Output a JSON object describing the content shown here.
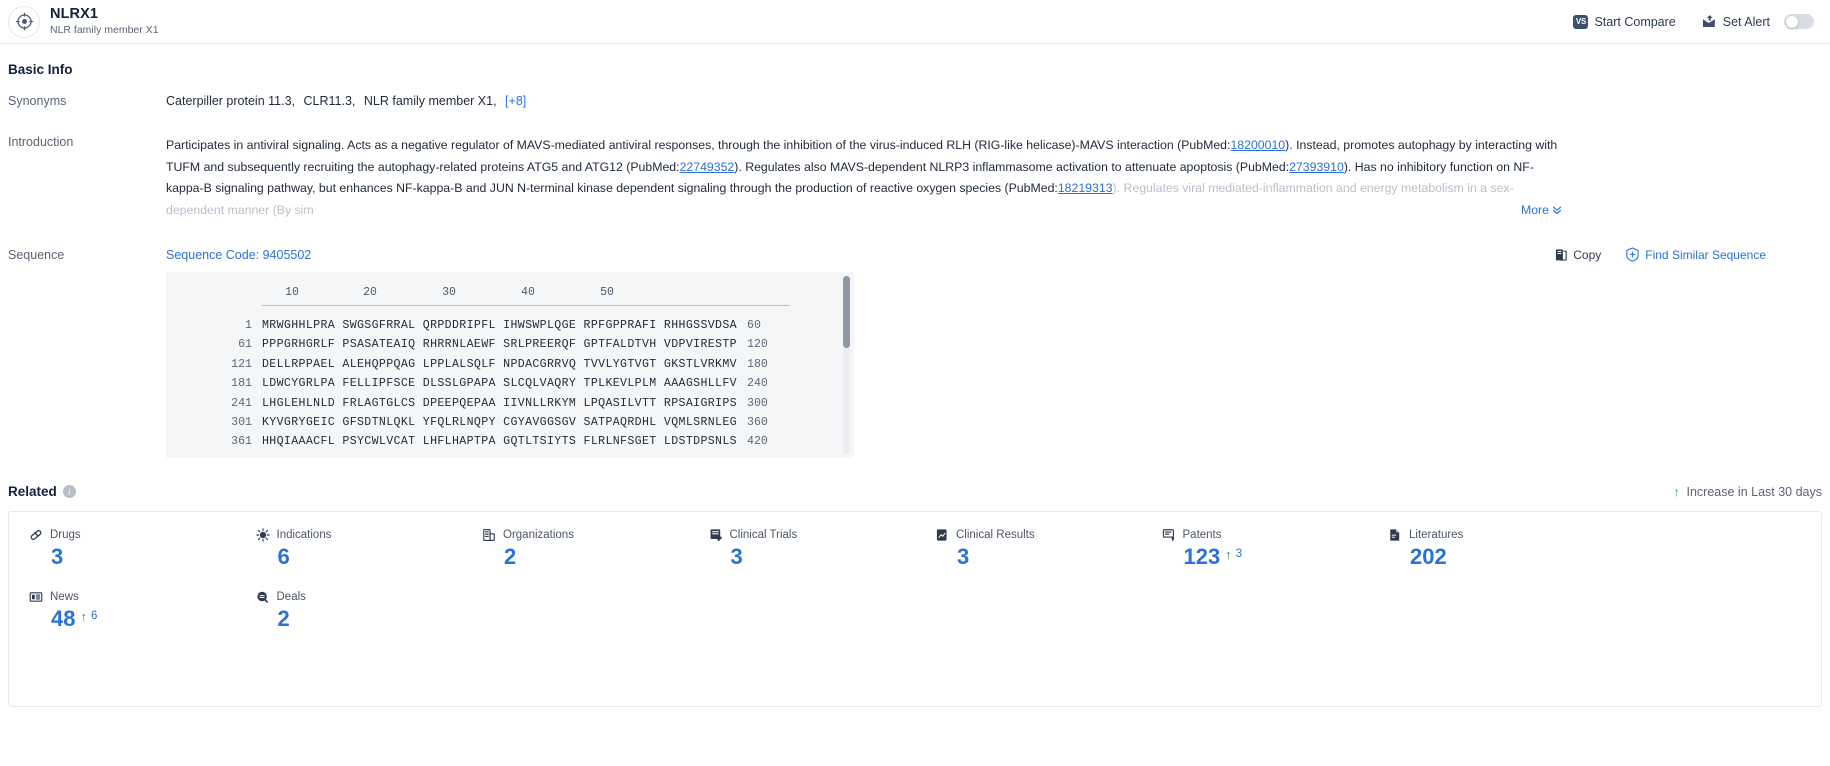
{
  "header": {
    "gene_symbol": "NLRX1",
    "gene_name": "NLR family member X1",
    "logo_icon": "target-crosshair-icon",
    "start_compare_label": "Start Compare",
    "vs_badge_text": "VS",
    "set_alert_label": "Set Alert",
    "alert_toggle_state": "off"
  },
  "basic_info": {
    "title": "Basic Info",
    "synonyms": {
      "label": "Synonyms",
      "values": [
        "Caterpiller protein 11.3,",
        "CLR11.3,",
        "NLR family member X1,"
      ],
      "more_label": "[+8]"
    },
    "introduction": {
      "label": "Introduction",
      "p1a": "Participates in antiviral signaling. Acts as a negative regulator of MAVS-mediated antiviral responses, through the inhibition of the virus-induced RLH (RIG-like helicase)-MAVS interaction (PubMed:",
      "pm1": "18200010",
      "p1b": "). Instead, promotes autophagy by interacting with TUFM and subsequently recruiting the autophagy-related proteins ATG5 and ATG12 (PubMed:",
      "pm2": "22749352",
      "p1c": "). Regulates also MAVS-dependent NLRP3 inflammasome activation to attenuate apoptosis (PubMed:",
      "pm3": "27393910",
      "p1d": "). Has no inhibitory function on NF-kappa-B signaling pathway, but enhances NF-kappa-B and JUN N-terminal kinase dependent signaling through the production of reactive oxygen species (PubMed:",
      "pm4": "18219313",
      "p1e": "). Regulates viral mediated-inflammation and energy metabolism in a sex-dependent manner (By sim",
      "more_label": "More",
      "more_icon": "chevron-double-down-icon"
    }
  },
  "sequence": {
    "label": "Sequence",
    "code_text": "Sequence Code: 9405502",
    "copy_label": "Copy",
    "copy_icon": "copy-icon",
    "find_similar_label": "Find Similar Sequence",
    "find_similar_icon": "similar-sequence-icon",
    "ruler_ticks": [
      "10",
      "20",
      "30",
      "40",
      "50"
    ],
    "lines": [
      {
        "start": "1",
        "chunks": "MRWGHHLPRA SWGSGFRRAL QRPDDRIPFL IHWSWPLQGE RPFGPPRAFI RHHGSSVDSA",
        "end": "60"
      },
      {
        "start": "61",
        "chunks": "PPPGRHGRLF PSASATEAIQ RHRRNLAEWF SRLPREERQF GPTFALDTVH VDPVIRESTP",
        "end": "120"
      },
      {
        "start": "121",
        "chunks": "DELLRPPAEL ALEHQPPQAG LPPLALSQLF NPDACGRRVQ TVVLYGTVGT GKSTLVRKMV",
        "end": "180"
      },
      {
        "start": "181",
        "chunks": "LDWCYGRLPA FELLIPFSCE DLSSLGPAPA SLCQLVAQRY TPLKEVLPLM AAAGSHLLFV",
        "end": "240"
      },
      {
        "start": "241",
        "chunks": "LHGLEHLNLD FRLAGTGLCS DPEEPQEPAA IIVNLLRKYM LPQASILVTT RPSAIGRIPS",
        "end": "300"
      },
      {
        "start": "301",
        "chunks": "KYVGRYGEIC GFSDTNLQKL YFQLRLNQPY CGYAVGGSGV SATPAQRDHL VQMLSRNLEG",
        "end": "360"
      },
      {
        "start": "361",
        "chunks": "HHQIAAACFL PSYCWLVCAT LHFLHAPTPA GQTLTSIYTS FLRLNFSGET LDSTDPSNLS",
        "end": "420"
      }
    ]
  },
  "related": {
    "title": "Related",
    "info_icon": "info-icon",
    "increase_note": "Increase in Last 30 days",
    "increase_icon": "arrow-up-icon",
    "tiles": [
      {
        "label": "Drugs",
        "icon": "capsule-icon",
        "value": "3",
        "delta": ""
      },
      {
        "label": "Indications",
        "icon": "virus-icon",
        "value": "6",
        "delta": ""
      },
      {
        "label": "Organizations",
        "icon": "building-icon",
        "value": "2",
        "delta": ""
      },
      {
        "label": "Clinical Trials",
        "icon": "clinical-trial-icon",
        "value": "3",
        "delta": ""
      },
      {
        "label": "Clinical Results",
        "icon": "clinical-result-icon",
        "value": "3",
        "delta": ""
      },
      {
        "label": "Patents",
        "icon": "patent-icon",
        "value": "123",
        "delta": "3"
      },
      {
        "label": "Literatures",
        "icon": "literature-icon",
        "value": "202",
        "delta": ""
      },
      {
        "label": "News",
        "icon": "news-icon",
        "value": "48",
        "delta": "6"
      },
      {
        "label": "Deals",
        "icon": "deal-icon",
        "value": "2",
        "delta": ""
      }
    ]
  },
  "colors": {
    "accent_blue": "#2a72d4",
    "dark_navy": "#13203a",
    "green_up": "#2e9b3f",
    "seq_bg": "#f5f6f8"
  }
}
